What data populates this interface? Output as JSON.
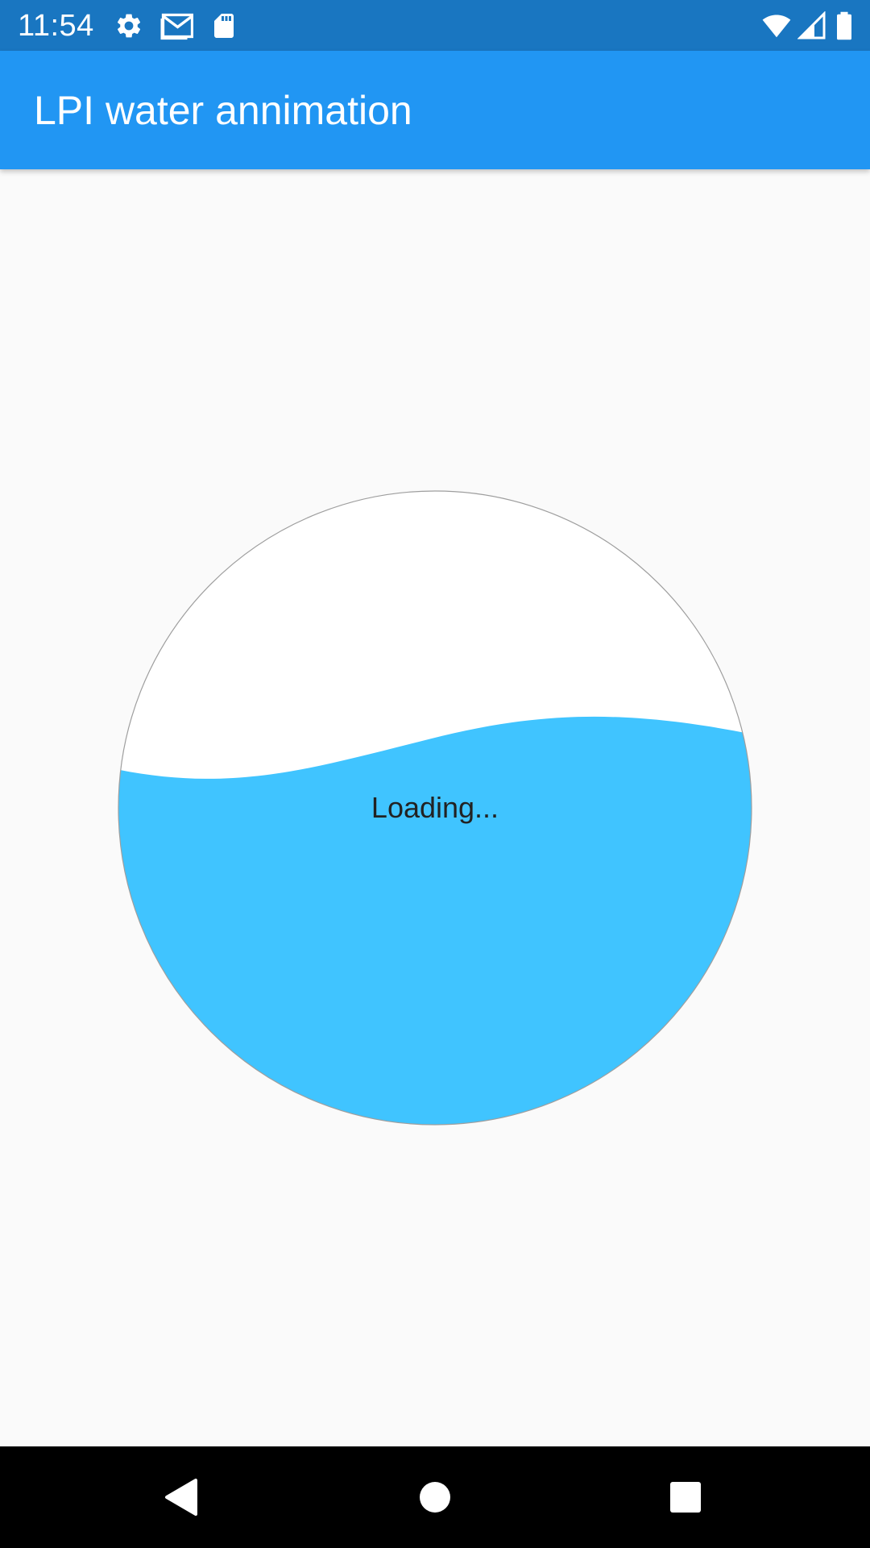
{
  "status_bar": {
    "time": "11:54",
    "background_color": "#1976c1",
    "left_icons": [
      "settings-icon",
      "gmail-icon",
      "sd-card-icon"
    ],
    "right_icons": [
      "wifi-icon",
      "signal-icon",
      "battery-icon"
    ]
  },
  "app_bar": {
    "title": "LPI water annimation",
    "background_color": "#2196f3"
  },
  "water_indicator": {
    "label": "Loading...",
    "water_color": "#40c4ff",
    "fill_fraction": 0.5
  },
  "nav_bar": {
    "buttons": [
      "back-icon",
      "home-icon",
      "recents-icon"
    ]
  }
}
